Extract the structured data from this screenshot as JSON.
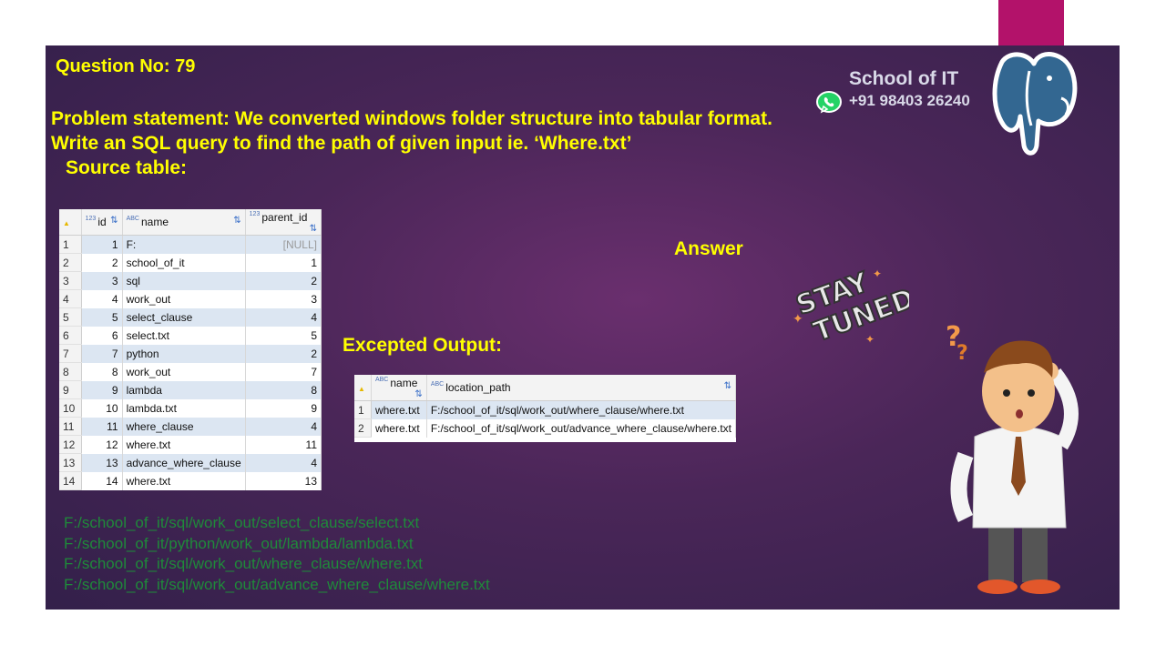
{
  "question_no": "Question No: 79",
  "problem_line1": "Problem statement: We converted windows folder structure into tabular format.",
  "problem_line2": "Write an SQL query to find the path of given input ie. ‘Where.txt’",
  "source_label": "Source table:",
  "answer_label": "Answer",
  "expected_label": "Excepted Output:",
  "brand": {
    "name": "School of IT",
    "phone": "+91 98403 26240"
  },
  "source_table": {
    "headers": [
      "id",
      "name",
      "parent_id"
    ],
    "rows": [
      {
        "rn": "1",
        "id": "1",
        "name": "F:",
        "parent": "[NULL]"
      },
      {
        "rn": "2",
        "id": "2",
        "name": "school_of_it",
        "parent": "1"
      },
      {
        "rn": "3",
        "id": "3",
        "name": "sql",
        "parent": "2"
      },
      {
        "rn": "4",
        "id": "4",
        "name": "work_out",
        "parent": "3"
      },
      {
        "rn": "5",
        "id": "5",
        "name": "select_clause",
        "parent": "4"
      },
      {
        "rn": "6",
        "id": "6",
        "name": "select.txt",
        "parent": "5"
      },
      {
        "rn": "7",
        "id": "7",
        "name": "python",
        "parent": "2"
      },
      {
        "rn": "8",
        "id": "8",
        "name": "work_out",
        "parent": "7"
      },
      {
        "rn": "9",
        "id": "9",
        "name": "lambda",
        "parent": "8"
      },
      {
        "rn": "10",
        "id": "10",
        "name": "lambda.txt",
        "parent": "9"
      },
      {
        "rn": "11",
        "id": "11",
        "name": "where_clause",
        "parent": "4"
      },
      {
        "rn": "12",
        "id": "12",
        "name": "where.txt",
        "parent": "11"
      },
      {
        "rn": "13",
        "id": "13",
        "name": "advance_where_clause",
        "parent": "4"
      },
      {
        "rn": "14",
        "id": "14",
        "name": "where.txt",
        "parent": "13"
      }
    ]
  },
  "output_table": {
    "headers": [
      "name",
      "location_path"
    ],
    "rows": [
      {
        "rn": "1",
        "name": "where.txt",
        "path": "F:/school_of_it/sql/work_out/where_clause/where.txt"
      },
      {
        "rn": "2",
        "name": "where.txt",
        "path": "F:/school_of_it/sql/work_out/advance_where_clause/where.txt"
      }
    ]
  },
  "paths": [
    "F:/school_of_it/sql/work_out/select_clause/select.txt",
    "F:/school_of_it/python/work_out/lambda/lambda.txt",
    "F:/school_of_it/sql/work_out/where_clause/where.txt",
    "F:/school_of_it/sql/work_out/advance_where_clause/where.txt"
  ],
  "stay_tuned": {
    "line1": "STAY",
    "line2": "TUNED"
  },
  "colors": {
    "title": "#ffff00",
    "paths": "#1f8a3a",
    "brand_bar": "#b3126a"
  }
}
